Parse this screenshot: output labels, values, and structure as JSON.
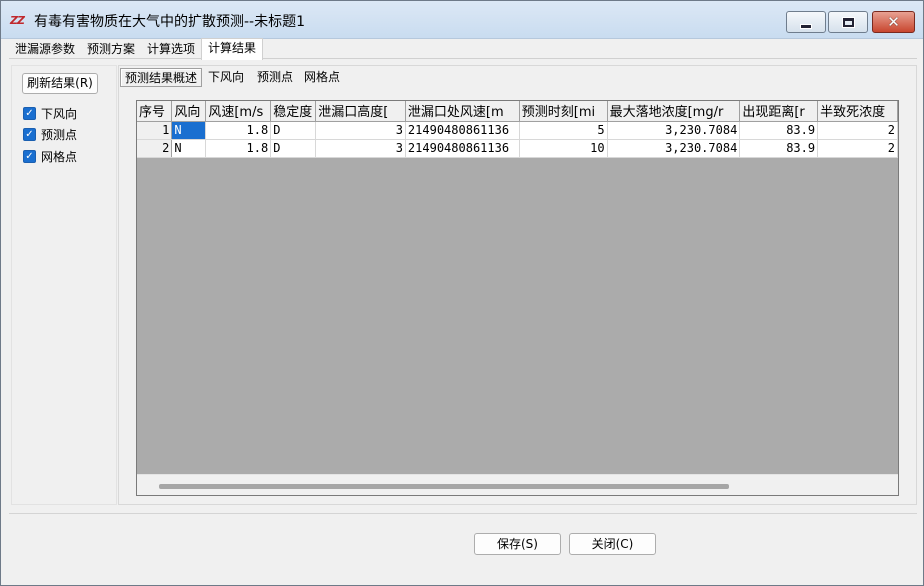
{
  "window": {
    "title": "有毒有害物质在大气中的扩散预测--未标题1",
    "icon": "app-logo-icon",
    "icon_text": "ZZ"
  },
  "menu_tabs": [
    "泄漏源参数",
    "预测方案",
    "计算选项",
    "计算结果"
  ],
  "active_menu_tab": "计算结果",
  "left_panel": {
    "refresh_label": "刷新结果(R)",
    "checkboxes": [
      {
        "label": "下风向",
        "checked": true
      },
      {
        "label": "预测点",
        "checked": true
      },
      {
        "label": "网格点",
        "checked": true
      }
    ]
  },
  "sub_tabs": [
    "预测结果概述",
    "下风向",
    "预测点",
    "网格点"
  ],
  "active_sub_tab": "预测结果概述",
  "grid": {
    "columns": [
      "序号",
      "风向",
      "风速[m/s",
      "稳定度",
      "泄漏口高度[",
      "泄漏口处风速[m",
      "预测时刻[mi",
      "最大落地浓度[mg/r",
      "出现距离[r",
      "半致死浓度"
    ],
    "rows": [
      [
        "1",
        "N",
        "1.8",
        "D",
        "3",
        "21490480861136",
        "5",
        "3,230.7084",
        "83.9",
        "2"
      ],
      [
        "2",
        "N",
        "1.8",
        "D",
        "3",
        "21490480861136",
        "10",
        "3,230.7084",
        "83.9",
        "2"
      ]
    ],
    "selected_cell": "N"
  },
  "footer": {
    "save_label": "保存(S)",
    "close_label": "关闭(C)"
  },
  "colors": {
    "selection": "#1a6fd0",
    "grid_background": "#ababab",
    "checkbox": "#1a6fd0"
  }
}
